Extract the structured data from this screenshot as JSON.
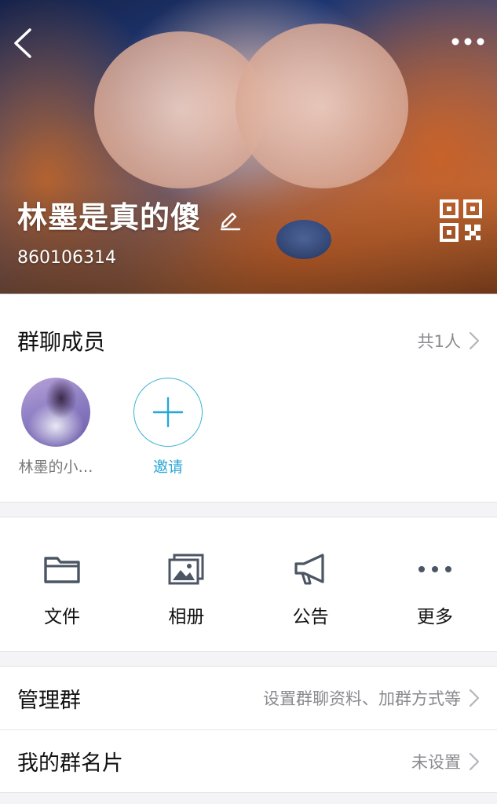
{
  "header": {
    "group_name": "林墨是真的傻",
    "group_id": "860106314",
    "back_icon": "back-chevron-icon",
    "more_icon": "more-dots-icon",
    "edit_icon": "edit-pencil-icon",
    "qr_icon": "qr-code-icon"
  },
  "members_section": {
    "title": "群聊成员",
    "count": "共1人",
    "members": [
      {
        "name": "林墨的小…"
      }
    ],
    "invite_label": "邀请"
  },
  "features": [
    {
      "icon": "folder-icon",
      "label": "文件"
    },
    {
      "icon": "album-icon",
      "label": "相册"
    },
    {
      "icon": "megaphone-icon",
      "label": "公告"
    },
    {
      "icon": "more-icon",
      "label": "更多"
    }
  ],
  "settings": {
    "manage": {
      "title": "管理群",
      "value": "设置群聊资料、加群方式等"
    },
    "card": {
      "title": "我的群名片",
      "value": "未设置"
    }
  },
  "colors": {
    "accent": "#2aa6d6",
    "text_primary": "#111111",
    "text_secondary": "#8a8a8f",
    "background": "#f4f4f6"
  }
}
